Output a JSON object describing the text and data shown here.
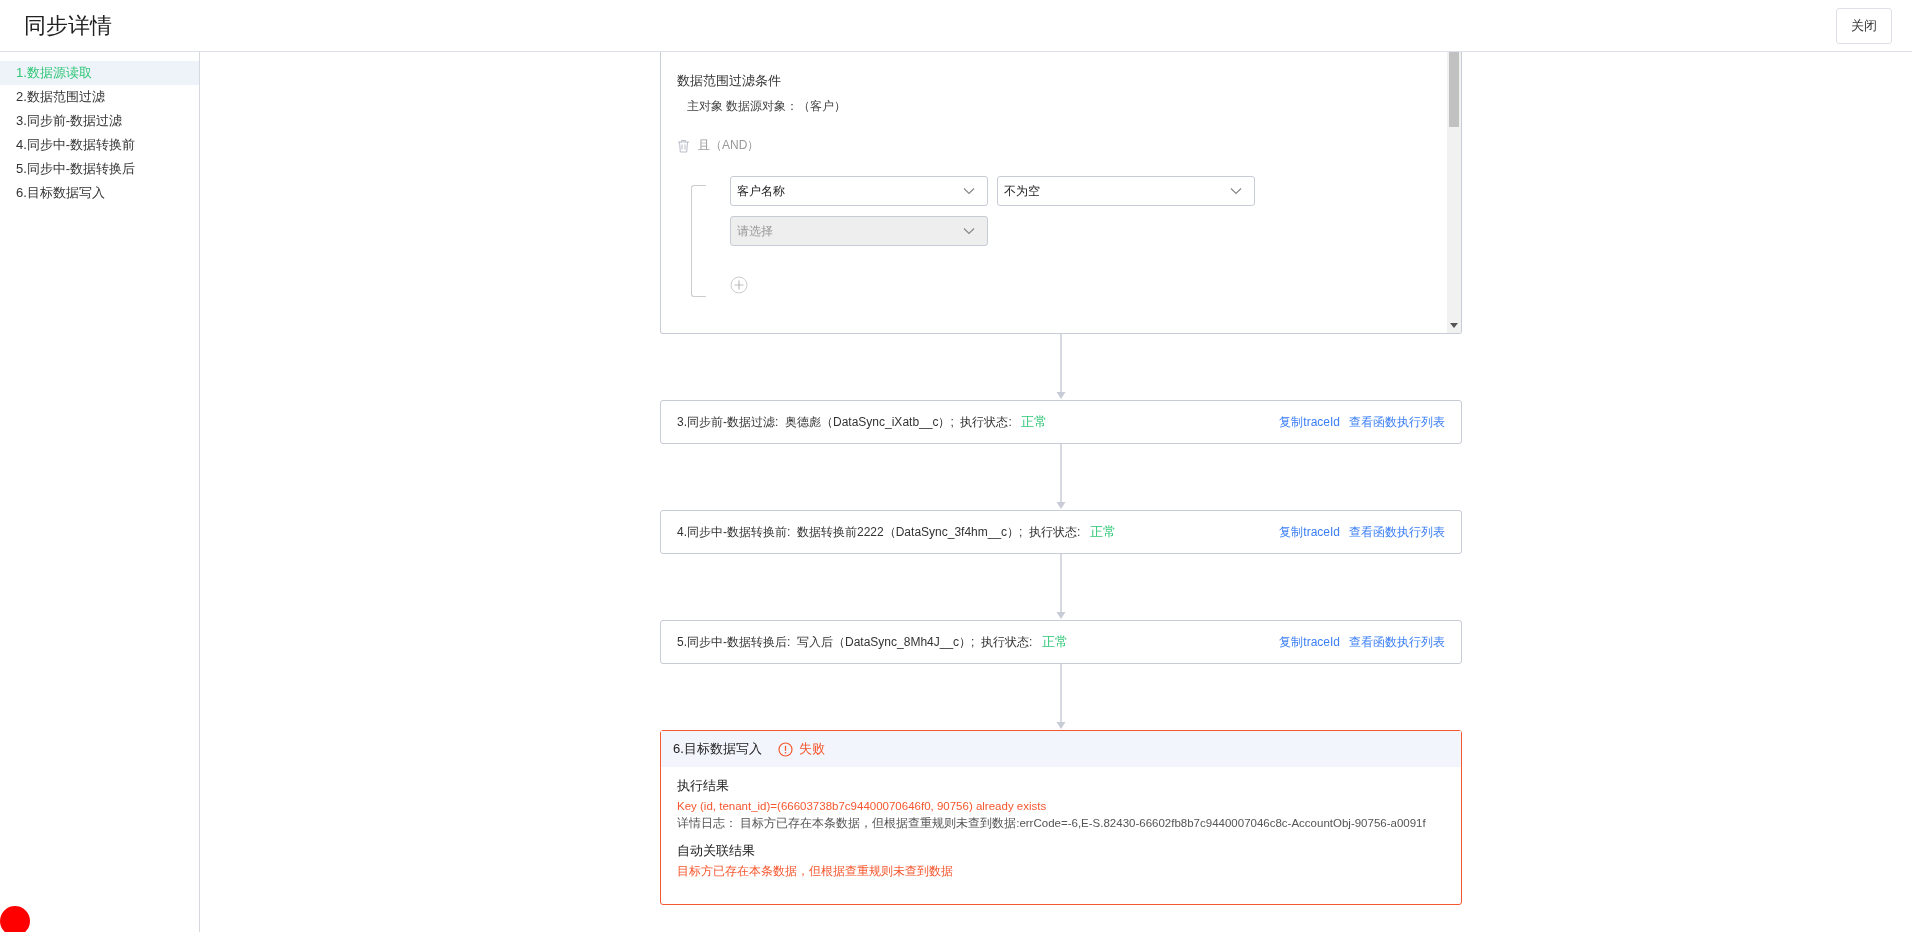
{
  "header": {
    "title": "同步详情",
    "close_button": "关闭"
  },
  "sidebar": {
    "items": [
      {
        "label": "1.数据源读取",
        "selected": true
      },
      {
        "label": "2.数据范围过滤",
        "selected": false
      },
      {
        "label": "3.同步前-数据过滤",
        "selected": false
      },
      {
        "label": "4.同步中-数据转换前",
        "selected": false
      },
      {
        "label": "5.同步中-数据转换后",
        "selected": false
      },
      {
        "label": "6.目标数据写入",
        "selected": false
      }
    ]
  },
  "filter_panel": {
    "title": "数据范围过滤条件",
    "object_line": "主对象 数据源对象：（客户）",
    "group_operator": "且（AND）",
    "rows": [
      {
        "selects": [
          {
            "value": "客户名称",
            "disabled": false
          },
          {
            "value": "不为空",
            "disabled": false
          }
        ]
      },
      {
        "selects": [
          {
            "placeholder": "请选择",
            "disabled": true
          }
        ]
      }
    ]
  },
  "steps": [
    {
      "description": "3.同步前-数据过滤:  奥德彪（DataSync_iXatb__c）;  执行状态:",
      "status": "正常",
      "ok": true,
      "links": [
        "复制traceId",
        "查看函数执行列表"
      ]
    },
    {
      "description": "4.同步中-数据转换前:  数据转换前2222（DataSync_3f4hm__c）;  执行状态:",
      "status": "正常",
      "ok": true,
      "links": [
        "复制traceId",
        "查看函数执行列表"
      ]
    },
    {
      "description": "5.同步中-数据转换后:  写入后（DataSync_8Mh4J__c）;  执行状态:",
      "status": "正常",
      "ok": true,
      "links": [
        "复制traceId",
        "查看函数执行列表"
      ]
    }
  ],
  "result_card": {
    "title": "6.目标数据写入",
    "status": "失败",
    "ok": false,
    "sections": [
      {
        "heading": "执行结果",
        "lines": [
          {
            "text": "Key (id, tenant_id)=(66603738b7c94400070646f0, 90756) already exists",
            "kind": "error"
          },
          {
            "text": "详情日志： 目标方已存在本条数据，但根据查重规则未查到数据:errCode=-6,E-S.82430-66602fb8b7c9440007046c8c-AccountObj-90756-a0091f",
            "kind": "detail"
          }
        ]
      },
      {
        "heading": "自动关联结果",
        "lines": [
          {
            "text": "目标方已存在本条数据，但根据查重规则未查到数据",
            "kind": "error"
          }
        ]
      }
    ]
  }
}
